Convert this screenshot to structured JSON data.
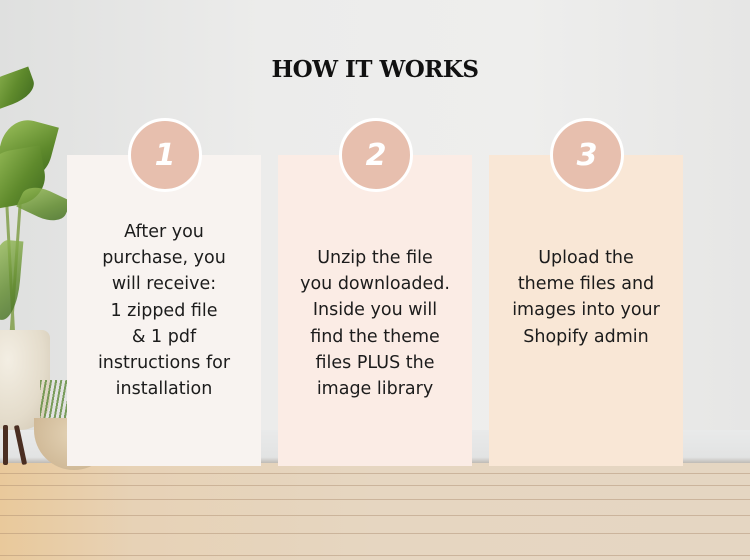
{
  "title": "HOW IT WORKS",
  "steps": [
    {
      "number": "1",
      "text": "After you\npurchase, you\nwill receive:\n1 zipped file\n& 1 pdf\ninstructions for\ninstallation"
    },
    {
      "number": "2",
      "text": "Unzip the file\nyou downloaded.\nInside you will\nfind the theme\nfiles PLUS the\nimage library"
    },
    {
      "number": "3",
      "text": "Upload the\ntheme files and\nimages into your\nShopify admin"
    }
  ],
  "colors": {
    "badge": "#e7bfae",
    "card1": "#f8f3f0",
    "card2": "#fbece5",
    "card3": "#f9e7d6"
  }
}
